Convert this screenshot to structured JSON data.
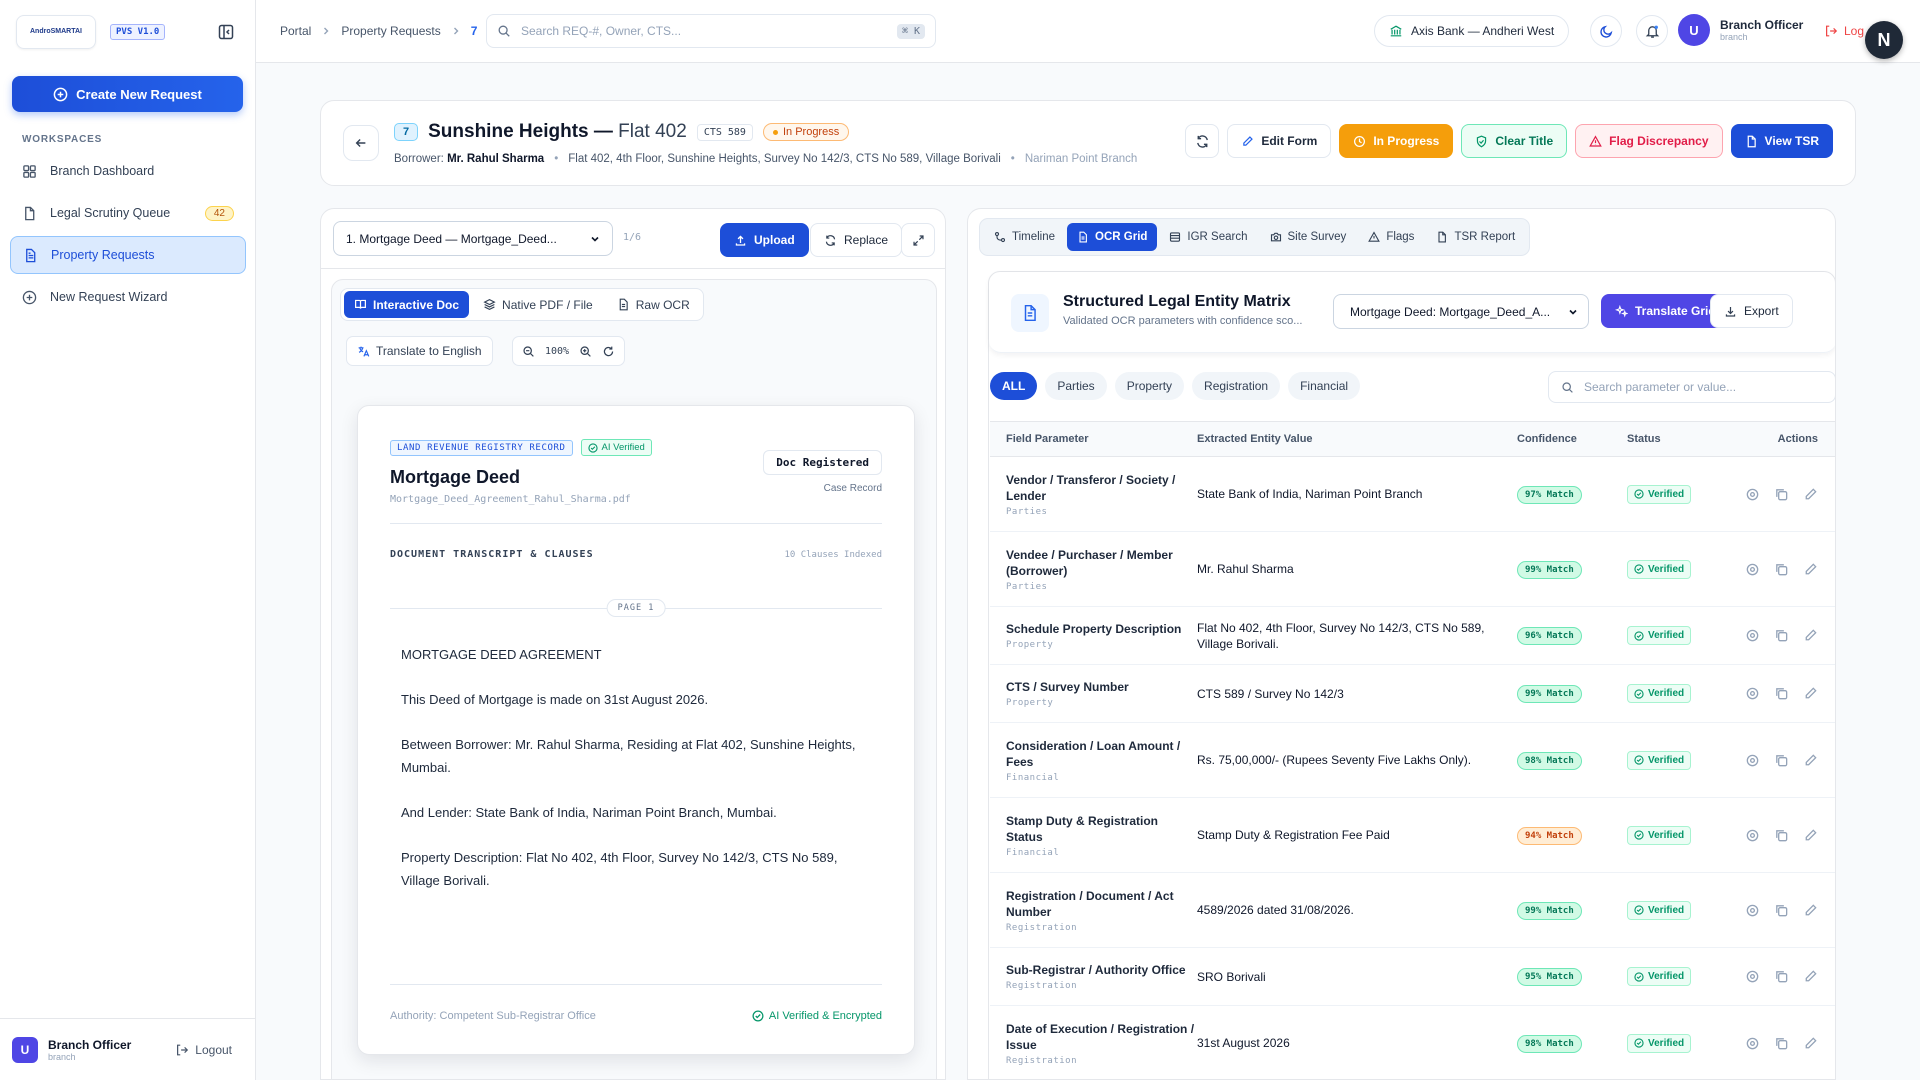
{
  "brand": {
    "logo_text": "AndroSMARTAI",
    "version": "PVS V1.0"
  },
  "sidebar": {
    "create_label": "Create New Request",
    "section_label": "WORKSPACES",
    "items": [
      {
        "label": "Branch Dashboard",
        "icon": "grid-icon"
      },
      {
        "label": "Legal Scrutiny Queue",
        "icon": "file-icon",
        "count": "42"
      },
      {
        "label": "Property Requests",
        "icon": "document-icon"
      },
      {
        "label": "New Request Wizard",
        "icon": "plus-circle-icon"
      }
    ],
    "user": {
      "initial": "U",
      "name": "Branch Officer",
      "role": "branch"
    },
    "logout_label": "Logout"
  },
  "topbar": {
    "breadcrumbs": [
      "Portal",
      "Property Requests",
      "7"
    ],
    "search_placeholder": "Search REQ-#, Owner, CTS...",
    "search_shortcut": "⌘ K",
    "bank": "Axis Bank — Andheri West",
    "user": {
      "initial": "U",
      "name": "Branch Officer",
      "role": "branch"
    },
    "logout_label": "Log",
    "assistant_initial": "N"
  },
  "header": {
    "request_no": "7",
    "title": "Sunshine Heights —",
    "title_light": "Flat 402",
    "cts": "CTS 589",
    "status": "In Progress",
    "borrower_label": "Borrower:",
    "borrower": "Mr. Rahul Sharma",
    "address": "Flat 402, 4th Floor, Sunshine Heights, Survey No 142/3, CTS No 589, Village Borivali",
    "branch": "Nariman Point Branch",
    "actions": {
      "edit": "Edit Form",
      "progress": "In Progress",
      "clear": "Clear Title",
      "flag": "Flag Discrepancy",
      "tsr": "View TSR"
    }
  },
  "left": {
    "doc_select": "1. Mortgage Deed — Mortgage_Deed...",
    "doc_count": "1/6",
    "upload": "Upload",
    "replace": "Replace",
    "view_tabs": [
      "Interactive Doc",
      "Native PDF / File",
      "Raw OCR"
    ],
    "translate": "Translate to English",
    "zoom": "100%",
    "paper": {
      "record_chip": "LAND REVENUE REGISTRY RECORD",
      "ai_chip": "AI Verified",
      "title": "Mortgage Deed",
      "file": "Mortgage_Deed_Agreement_Rahul_Sharma.pdf",
      "registered": "Doc Registered",
      "case_record": "Case Record",
      "transcript_label": "DOCUMENT TRANSCRIPT & CLAUSES",
      "clause_count": "10 Clauses Indexed",
      "page_label": "PAGE 1",
      "paragraphs": [
        "MORTGAGE DEED AGREEMENT",
        "This Deed of Mortgage is made on 31st August 2026.",
        "Between Borrower: Mr. Rahul Sharma, Residing at Flat 402, Sunshine Heights, Mumbai.",
        "And Lender: State Bank of India, Nariman Point Branch, Mumbai.",
        "Property Description: Flat No 402, 4th Floor, Survey No 142/3, CTS No 589, Village Borivali."
      ],
      "authority": "Authority: Competent Sub-Registrar Office",
      "encrypted": "AI Verified & Encrypted"
    }
  },
  "right": {
    "tabs": [
      "Timeline",
      "OCR Grid",
      "IGR Search",
      "Site Survey",
      "Flags",
      "TSR Report"
    ],
    "matrix_title": "Structured Legal Entity Matrix",
    "matrix_sub": "Validated OCR parameters with confidence sco...",
    "matrix_select": "Mortgage Deed: Mortgage_Deed_A...",
    "translate_grid": "Translate Grid",
    "export": "Export",
    "filters": [
      "ALL",
      "Parties",
      "Property",
      "Registration",
      "Financial"
    ],
    "search_placeholder": "Search parameter or value...",
    "columns": [
      "Field Parameter",
      "Extracted Entity Value",
      "Confidence",
      "Status",
      "Actions"
    ],
    "rows": [
      {
        "param": "Vendor / Transferor / Society / Lender",
        "cat": "Parties",
        "value": "State Bank of India, Nariman Point Branch",
        "conf": "97% Match",
        "status": "Verified"
      },
      {
        "param": "Vendee / Purchaser / Member (Borrower)",
        "cat": "Parties",
        "value": "Mr. Rahul Sharma",
        "conf": "99% Match",
        "status": "Verified"
      },
      {
        "param": "Schedule Property Description",
        "cat": "Property",
        "value": "Flat No 402, 4th Floor, Survey No 142/3, CTS No 589, Village Borivali.",
        "conf": "96% Match",
        "status": "Verified"
      },
      {
        "param": "CTS / Survey Number",
        "cat": "Property",
        "value": "CTS 589 / Survey No 142/3",
        "conf": "99% Match",
        "status": "Verified"
      },
      {
        "param": "Consideration / Loan Amount / Fees",
        "cat": "Financial",
        "value": "Rs. 75,00,000/- (Rupees Seventy Five Lakhs Only).",
        "conf": "98% Match",
        "status": "Verified"
      },
      {
        "param": "Stamp Duty & Registration Status",
        "cat": "Financial",
        "value": "Stamp Duty & Registration Fee Paid",
        "conf": "94% Match",
        "status": "Verified"
      },
      {
        "param": "Registration / Document / Act Number",
        "cat": "Registration",
        "value": "4589/2026 dated 31/08/2026.",
        "conf": "99% Match",
        "status": "Verified"
      },
      {
        "param": "Sub-Registrar / Authority Office",
        "cat": "Registration",
        "value": "SRO Borivali",
        "conf": "95% Match",
        "status": "Verified"
      },
      {
        "param": "Date of Execution / Registration / Issue",
        "cat": "Registration",
        "value": "31st August 2026",
        "conf": "98% Match",
        "status": "Verified"
      }
    ]
  },
  "colors": {
    "primary": "#1d4ed8",
    "warning": "#f59e0b",
    "success": "#059669",
    "danger": "#e11d48",
    "indigo": "#4f46e5"
  }
}
